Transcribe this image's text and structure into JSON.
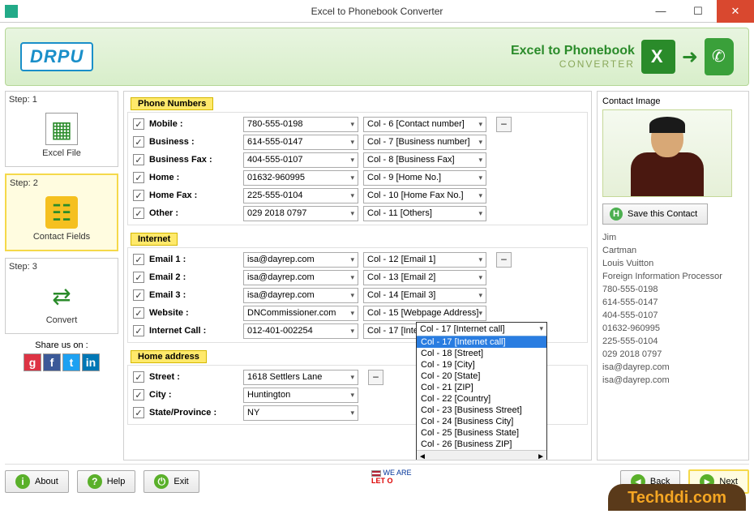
{
  "window": {
    "title": "Excel to Phonebook Converter"
  },
  "banner": {
    "logo": "DRPU",
    "title_a": "Excel to ",
    "title_b": "Phonebook",
    "subtitle": "CONVERTER"
  },
  "steps": {
    "s1_label": "Step: 1",
    "s1_name": "Excel File",
    "s2_label": "Step:  2",
    "s2_name": "Contact Fields",
    "s3_label": "Step: 3",
    "s3_name": "Convert",
    "share_label": "Share us on :"
  },
  "sections": {
    "phone_title": "Phone Numbers",
    "phone_rows": [
      {
        "label": "Mobile :",
        "value": "780-555-0198",
        "col": "Col - 6 [Contact number]"
      },
      {
        "label": "Business :",
        "value": "614-555-0147",
        "col": "Col - 7 [Business number]"
      },
      {
        "label": "Business Fax :",
        "value": "404-555-0107",
        "col": "Col - 8 [Business Fax]"
      },
      {
        "label": "Home :",
        "value": "01632-960995",
        "col": "Col - 9 [Home No.]"
      },
      {
        "label": "Home Fax :",
        "value": "225-555-0104",
        "col": "Col - 10 [Home Fax No.]"
      },
      {
        "label": "Other :",
        "value": "029 2018 0797",
        "col": "Col - 11 [Others]"
      }
    ],
    "internet_title": "Internet",
    "internet_rows": [
      {
        "label": "Email 1 :",
        "value": "isa@dayrep.com",
        "col": "Col - 12 [Email 1]"
      },
      {
        "label": "Email 2 :",
        "value": "isa@dayrep.com",
        "col": "Col - 13 [Email 2]"
      },
      {
        "label": "Email 3 :",
        "value": "isa@dayrep.com",
        "col": "Col - 14 [Email 3]"
      },
      {
        "label": "Website :",
        "value": "DNCommissioner.com",
        "col": "Col - 15 [Webpage Address]"
      },
      {
        "label": "Internet Call :",
        "value": "012-401-002254",
        "col": "Col - 17 [Internet call]"
      }
    ],
    "home_title": "Home address",
    "home_rows": [
      {
        "label": "Street :",
        "value": "1618 Settlers Lane",
        "col": ""
      },
      {
        "label": "City :",
        "value": "Huntington",
        "col": ""
      },
      {
        "label": "State/Province :",
        "value": "NY",
        "col": ""
      }
    ]
  },
  "dropdown": {
    "selected": "Col - 17 [Internet call]",
    "items": [
      "Col - 17 [Internet call]",
      "Col - 18 [Street]",
      "Col - 19 [City]",
      "Col - 20 [State]",
      "Col - 21 [ZIP]",
      "Col - 22 [Country]",
      "Col - 23 [Business Street]",
      "Col - 24 [Business City]",
      "Col - 25 [Business State]",
      "Col - 26 [Business ZIP]"
    ]
  },
  "contact": {
    "image_label": "Contact Image",
    "save_label": "Save this Contact",
    "info": [
      "Jim",
      "Cartman",
      "Louis Vuitton",
      "Foreign Information Processor",
      "780-555-0198",
      "614-555-0147",
      "404-555-0107",
      "01632-960995",
      "225-555-0104",
      "029 2018 0797",
      "isa@dayrep.com",
      "isa@dayrep.com"
    ]
  },
  "footer": {
    "about": "About",
    "help": "Help",
    "exit": "Exit",
    "back": "Back",
    "next": "Next",
    "note1": "WE ARE",
    "note2": "LET O"
  },
  "watermark": "Techddi.com"
}
